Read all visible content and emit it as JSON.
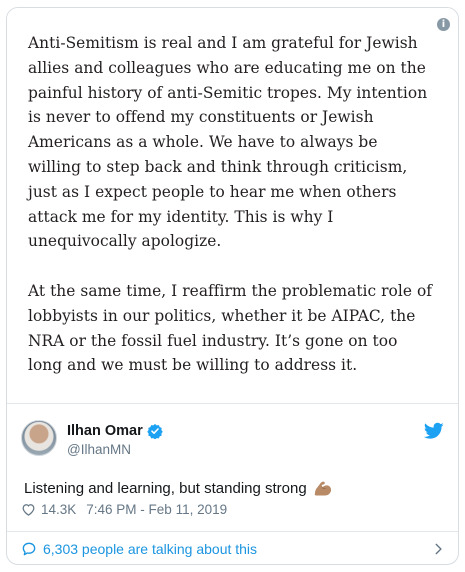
{
  "statement": {
    "paragraph1": "Anti-Semitism is real and I am grateful for Jewish\nallies and colleagues who are educating me on the\npainful history of anti-Semitic tropes. My intention\nis never to offend my constituents or Jewish\nAmericans as a whole. We have to always be\nwilling to step back and think through criticism,\njust as I expect people to hear me when others\nattack me for my identity. This is why I\nunequivocally apologize.",
    "paragraph2": "At the same time, I reaffirm the problematic role of\nlobbyists in our politics, whether it be AIPAC, the\nNRA or the fossil fuel industry. It’s gone on too\nlong and we must be willing to address it."
  },
  "info_icon": {
    "icon": "info-icon",
    "glyph": "i"
  },
  "author": {
    "display_name": "Ilhan Omar",
    "handle": "@IlhanMN",
    "verified": true
  },
  "tweet": {
    "text": "Listening and learning, but standing strong",
    "emoji": "flexed-biceps"
  },
  "meta": {
    "likes": "14.3K",
    "timestamp": "7:46 PM - Feb 11, 2019"
  },
  "conversation": {
    "label": "6,303 people are talking about this"
  },
  "colors": {
    "link": "#1b95e0",
    "muted": "#657786",
    "text": "#14171a",
    "twitter_blue": "#1da1f2"
  }
}
